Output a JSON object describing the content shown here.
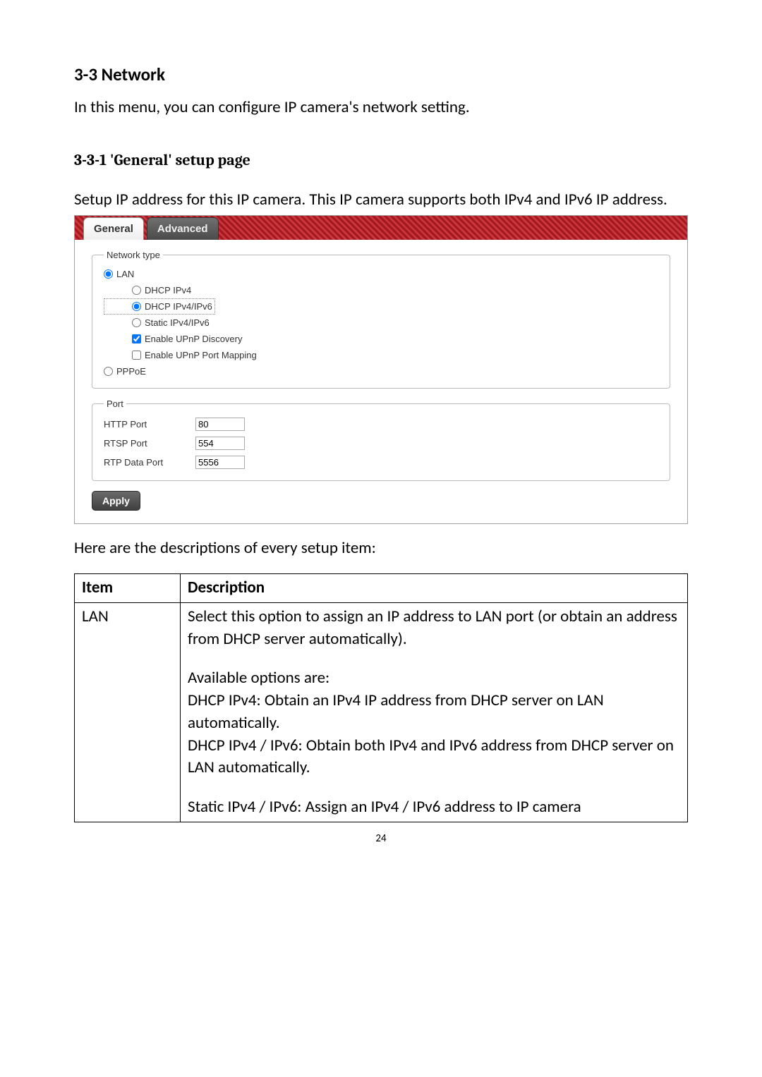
{
  "headings": {
    "section": "3-3 Network",
    "section_intro": "In this menu, you can configure IP camera's network setting.",
    "subsection": "3-3-1 'General' setup page",
    "subsection_intro": "Setup IP address for this IP camera. This IP camera supports both IPv4 and IPv6 IP address."
  },
  "screenshot": {
    "tabs": {
      "general": "General",
      "advanced": "Advanced"
    },
    "groups": {
      "network_type": {
        "legend": "Network type",
        "lan": "LAN",
        "dhcp_ipv4": "DHCP IPv4",
        "dhcp_ipv4_ipv6": "DHCP IPv4/IPv6",
        "static_ipv4_ipv6": "Static IPv4/IPv6",
        "enable_upnp_discovery": "Enable UPnP Discovery",
        "enable_upnp_port_mapping": "Enable UPnP Port Mapping",
        "pppoe": "PPPoE"
      },
      "port": {
        "legend": "Port",
        "http_port_label": "HTTP Port",
        "http_port_value": "80",
        "rtsp_port_label": "RTSP Port",
        "rtsp_port_value": "554",
        "rtp_data_port_label": "RTP Data Port",
        "rtp_data_port_value": "5556"
      }
    },
    "apply_label": "Apply"
  },
  "after_screenshot": "Here are the descriptions of every setup item:",
  "table": {
    "header_item": "Item",
    "header_desc": "Description",
    "row1_item": "LAN",
    "row1_desc_p1": "Select this option to assign an IP address to LAN port (or obtain an address from DHCP server automatically).",
    "row1_desc_p2a": "Available options are:",
    "row1_desc_p2b": "DHCP IPv4: Obtain an IPv4 IP address from DHCP server on LAN automatically.",
    "row1_desc_p2c": "DHCP IPv4 / IPv6: Obtain both IPv4 and IPv6 address from DHCP server on LAN automatically.",
    "row1_desc_p3": "Static IPv4 / IPv6: Assign an IPv4 / IPv6 address to IP camera"
  },
  "page_number": "24"
}
